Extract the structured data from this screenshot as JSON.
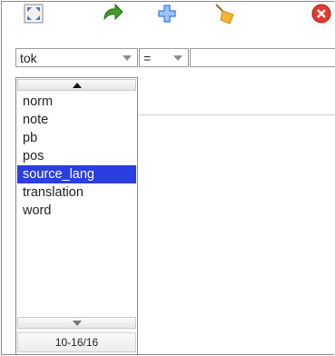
{
  "toolbar": {
    "icons": [
      "fullscreen-icon",
      "redo-arrow-icon",
      "add-icon",
      "broom-icon",
      "close-icon"
    ],
    "colors": {
      "arrow": "#3f9b2b",
      "add": "#3a7de0",
      "broom": "#f2b632",
      "close": "#e23b2e"
    }
  },
  "field_row": {
    "attribute_value": "tok",
    "operator_value": "=",
    "value_text": ""
  },
  "dropdown": {
    "items": [
      "norm",
      "note",
      "pb",
      "pos",
      "source_lang",
      "translation",
      "word"
    ],
    "selected": "source_lang",
    "counter": "10-16/16",
    "selected_color": "#2a3fe0"
  }
}
